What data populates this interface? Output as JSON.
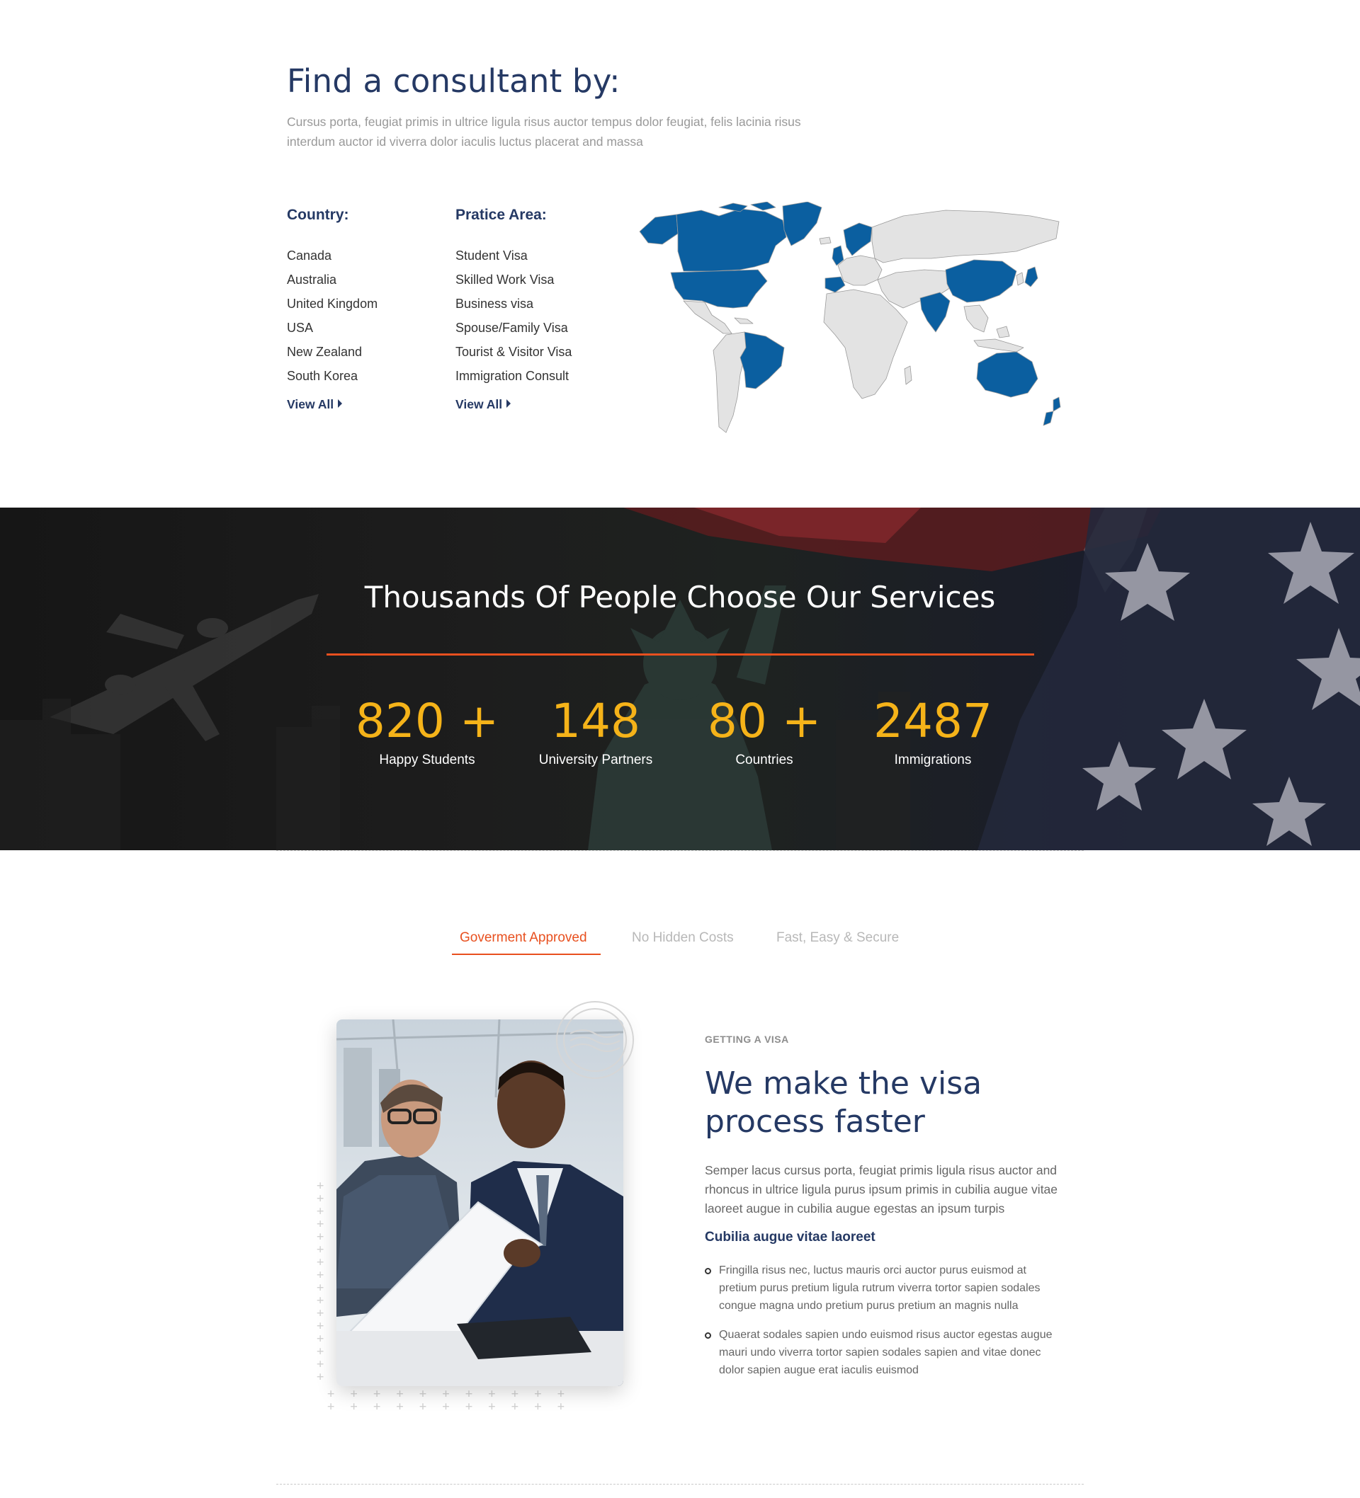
{
  "find": {
    "title": "Find a consultant by:",
    "intro": "Cursus porta, feugiat primis in ultrice ligula risus auctor tempus dolor feugiat, felis lacinia risus interdum auctor id viverra dolor iaculis luctus placerat and massa",
    "country": {
      "heading": "Country:",
      "items": [
        "Canada",
        "Australia",
        "United Kingdom",
        "USA",
        "New Zealand",
        "South Korea"
      ],
      "view_all": "View All"
    },
    "practice": {
      "heading": "Pratice Area:",
      "items": [
        "Student Visa",
        "Skilled Work Visa",
        "Business visa",
        "Spouse/Family Visa",
        "Tourist & Visitor Visa",
        "Immigration Consult"
      ],
      "view_all": "View All"
    },
    "map": {
      "highlight_color": "#0b5fa0",
      "base_color": "#e3e3e3",
      "highlighted_regions": [
        "Canada",
        "USA",
        "Greenland",
        "Brazil",
        "United Kingdom",
        "Scandinavia",
        "China",
        "India",
        "Japan",
        "Australia",
        "New Zealand"
      ]
    }
  },
  "stats": {
    "title": "Thousands Of People Choose Our Services",
    "items": [
      {
        "value": "820 +",
        "label": "Happy Students"
      },
      {
        "value": "148",
        "label": "University Partners"
      },
      {
        "value": "80 +",
        "label": "Countries"
      },
      {
        "value": "2487",
        "label": "Immigrations"
      }
    ],
    "accent": "#e8501f",
    "number_color": "#f5b319"
  },
  "tabs": [
    {
      "label": "Goverment Approved",
      "active": true
    },
    {
      "label": "No Hidden Costs",
      "active": false
    },
    {
      "label": "Fast, Easy & Secure",
      "active": false
    }
  ],
  "visa": {
    "eyebrow": "GETTING A VISA",
    "title": "We make the visa process faster",
    "paragraph": "Semper lacus cursus porta, feugiat primis ligula risus auctor and rhoncus in ultrice ligula purus ipsum primis in cubilia augue vitae laoreet augue in cubilia augue egestas an ipsum turpis",
    "subheading": "Cubilia augue vitae laoreet",
    "bullets": [
      "Fringilla risus nec, luctus mauris orci auctor purus euismod at pretium purus pretium ligula rutrum viverra tortor sapien sodales congue magna undo pretium purus pretium an magnis nulla",
      "Quaerat sodales sapien undo euismod risus auctor egestas augue mauri undo viverra tortor sapien sodales sapien and vitae donec dolor sapien augue erat iaculis euismod"
    ]
  }
}
